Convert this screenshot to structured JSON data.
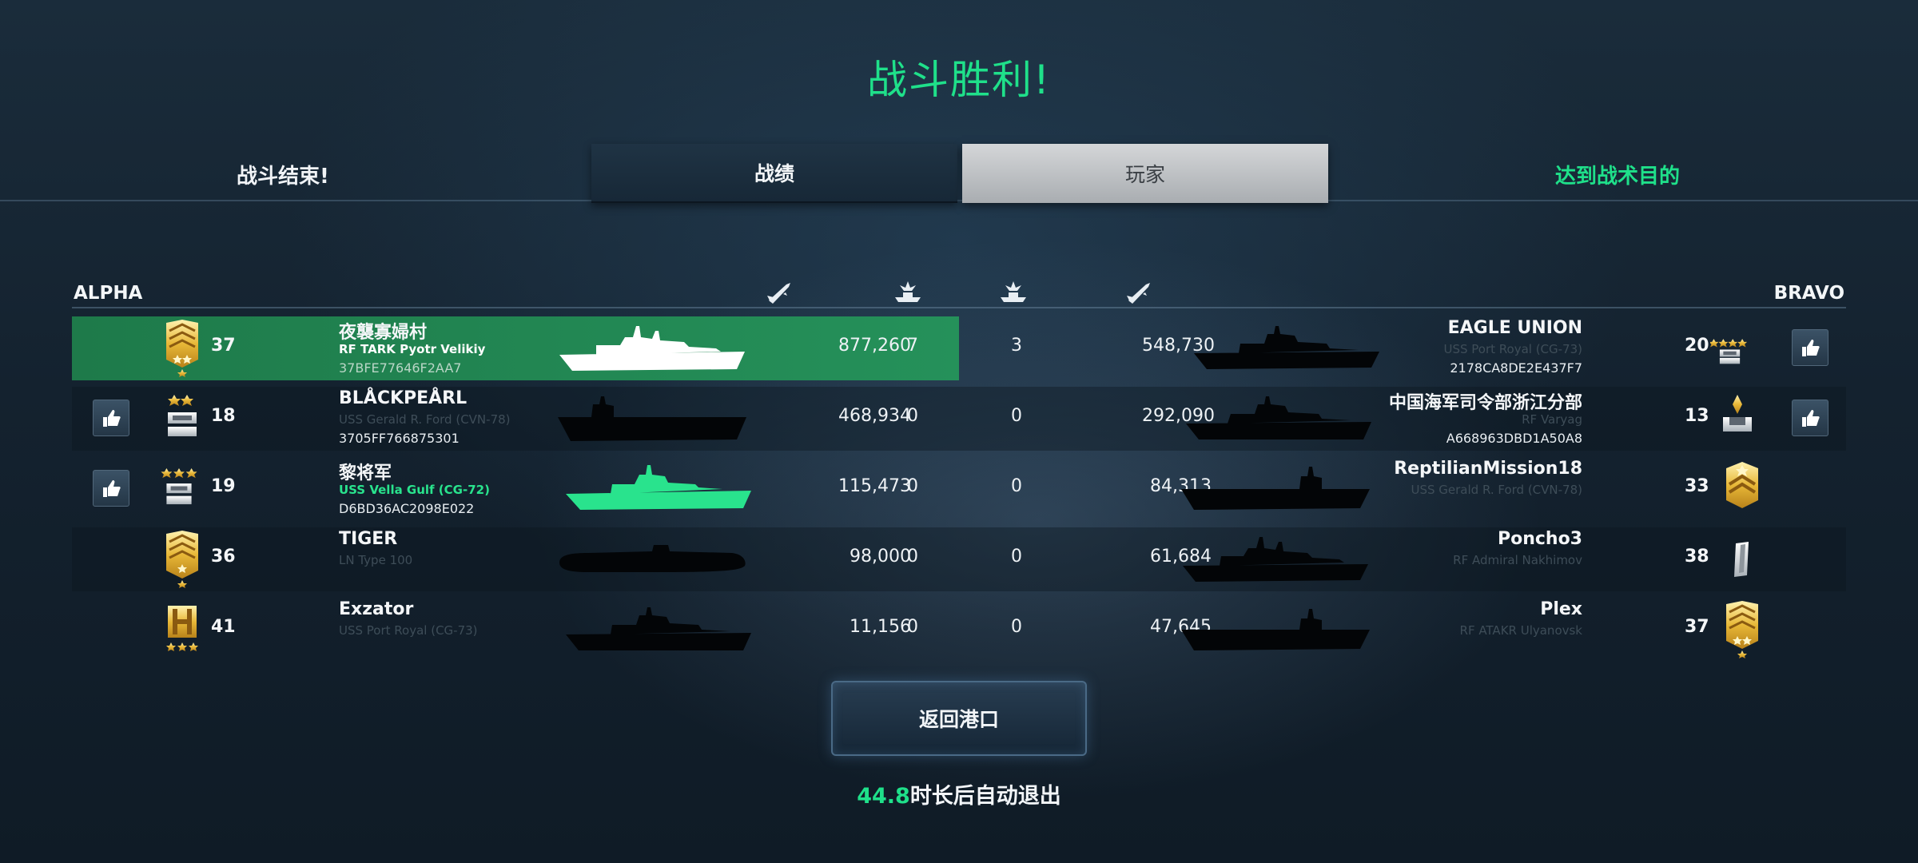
{
  "title": "战斗胜利!",
  "status_left": "战斗结束!",
  "status_right": "达到战术目的",
  "tabs": [
    {
      "label": "战绩",
      "active": false
    },
    {
      "label": "玩家",
      "active": true
    }
  ],
  "teams": {
    "alpha": "ALPHA",
    "bravo": "BRAVO"
  },
  "column_icons": [
    "missile-damage-icon",
    "ship-kills-icon",
    "ship-kills-icon",
    "missile-damage-icon"
  ],
  "alpha": [
    {
      "level": "37",
      "name": "夜襲寡婦村",
      "ship": "RF TARK Pyotr Velikiy",
      "id": "37BFE77646F2AA7",
      "damage": "877,260",
      "kills": "7",
      "rank_icon": "sergeant-major-rank-icon",
      "ship_icon": "battlecruiser-silhouette-icon",
      "liked": false,
      "highlighted": true
    },
    {
      "level": "18",
      "name": "BLÅCKPEÅRL",
      "ship": "USS Gerald R. Ford (CVN-78)",
      "id": "3705FF766875301",
      "damage": "468,934",
      "kills": "0",
      "rank_icon": "two-star-bar-rank-icon",
      "ship_icon": "carrier-silhouette-icon",
      "liked": true
    },
    {
      "level": "19",
      "name": "黎将军",
      "ship": "USS Vella Gulf (CG-72)",
      "id": "D6BD36AC2098E022",
      "damage": "115,473",
      "kills": "0",
      "rank_icon": "three-star-bar-rank-icon",
      "ship_icon": "cruiser-silhouette-icon",
      "liked": true,
      "self": true
    },
    {
      "level": "36",
      "name": "TIGER",
      "ship": "LN Type 100",
      "id": "",
      "damage": "98,000",
      "kills": "0",
      "rank_icon": "sergeant-major-rank-icon",
      "ship_icon": "submarine-silhouette-icon",
      "liked": false
    },
    {
      "level": "41",
      "name": "Exzator",
      "ship": "USS Port Royal (CG-73)",
      "id": "",
      "damage": "11,156",
      "kills": "0",
      "rank_icon": "gold-bar-three-star-rank-icon",
      "ship_icon": "cruiser-silhouette-icon",
      "liked": false
    }
  ],
  "bravo": [
    {
      "level": "20",
      "name": "EAGLE UNION",
      "ship": "USS Port Royal (CG-73)",
      "id": "2178CA8DE2E437F7",
      "damage": "548,730",
      "kills": "3",
      "rank_icon": "four-star-bar-rank-icon",
      "ship_icon": "cruiser-silhouette-icon",
      "liked": true
    },
    {
      "level": "13",
      "name": "中国海军司令部浙江分部",
      "ship": "RF Varyag",
      "id": "A668963DBD1A50A8",
      "damage": "292,090",
      "kills": "0",
      "rank_icon": "single-bar-rank-icon",
      "ship_icon": "cruiser-silhouette-icon",
      "liked": true
    },
    {
      "level": "33",
      "name": "ReptilianMission18",
      "ship": "USS Gerald R. Ford (CVN-78)",
      "id": "",
      "damage": "84,313",
      "kills": "0",
      "rank_icon": "chevron-star-rank-icon",
      "ship_icon": "carrier-silhouette-icon",
      "liked": false
    },
    {
      "level": "38",
      "name": "Poncho3",
      "ship": "RF Admiral Nakhimov",
      "id": "",
      "damage": "61,684",
      "kills": "0",
      "rank_icon": "silver-bar-rank-icon",
      "ship_icon": "battlecruiser-silhouette-icon",
      "liked": false
    },
    {
      "level": "37",
      "name": "Plex",
      "ship": "RF ATAKR Ulyanovsk",
      "id": "",
      "damage": "47,645",
      "kills": "0",
      "rank_icon": "sergeant-major-rank-icon",
      "ship_icon": "carrier-silhouette-icon",
      "liked": false
    }
  ],
  "return_button": "返回港口",
  "auto_exit": {
    "seconds": "44.8",
    "text": "时长后自动退出"
  },
  "colors": {
    "accent_green": "#1fe08a",
    "highlight_row": "#25915a",
    "tab_active": "#c4c7ca"
  }
}
